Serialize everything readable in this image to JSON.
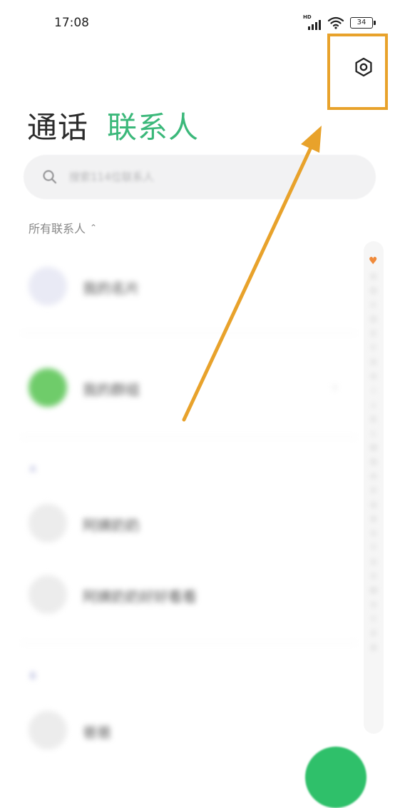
{
  "status_bar": {
    "time": "17:08",
    "hd_label": "HD",
    "battery": "34"
  },
  "header": {
    "settings_icon": "settings-hexagon-icon"
  },
  "tabs": [
    {
      "label": "通话",
      "active": false
    },
    {
      "label": "联系人",
      "active": true
    }
  ],
  "search": {
    "placeholder": "搜索114位联系人",
    "icon": "search-icon"
  },
  "filter": {
    "label": "所有联系人",
    "icon": "sort-chevron-icon"
  },
  "contacts": {
    "my_card": "我的名片",
    "my_groups": "我的群组",
    "section_a": "A",
    "contact_1": "阿姨奶奶",
    "contact_2": "阿姨奶奶好好看看",
    "section_b": "B",
    "contact_3": "爸爸"
  },
  "index_bar": {
    "favorite_icon": "heart-icon",
    "letters": [
      "A",
      "B",
      "C",
      "D",
      "E",
      "F",
      "G",
      "H",
      "I",
      "J",
      "K",
      "L",
      "M",
      "N",
      "O",
      "P",
      "Q",
      "R",
      "S",
      "T",
      "U",
      "V",
      "W",
      "X",
      "Y",
      "Z",
      "#"
    ]
  },
  "colors": {
    "accent_green": "#3bb87a",
    "annotation_orange": "#e8a22b",
    "fab_green": "#2fc06a"
  }
}
